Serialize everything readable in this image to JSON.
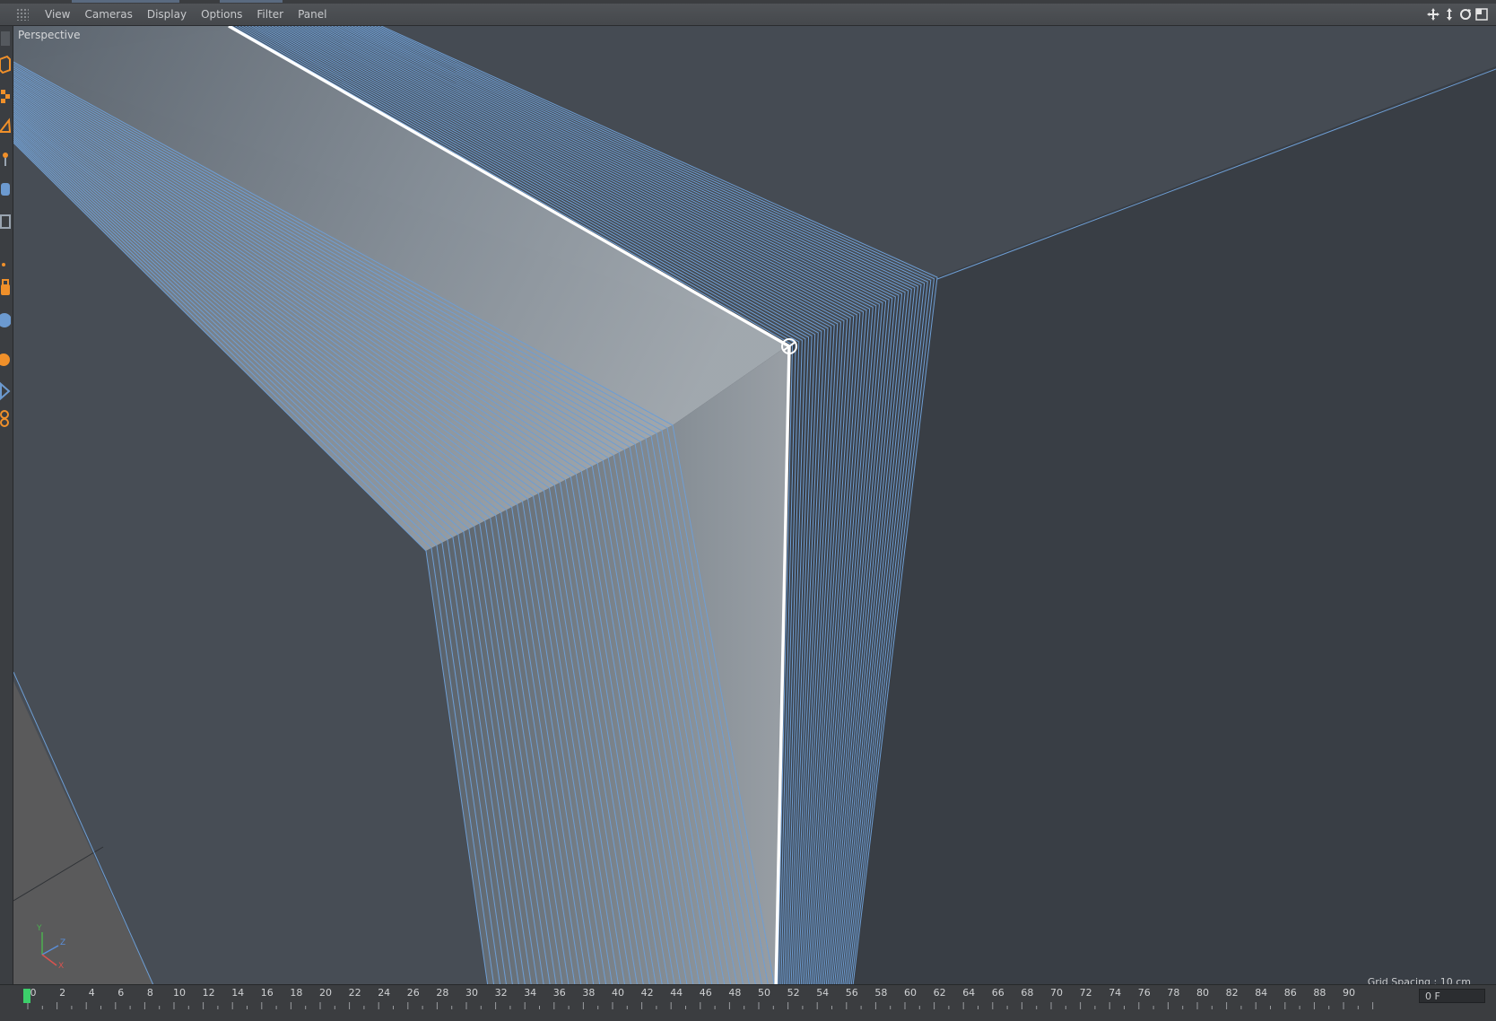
{
  "menubar": {
    "items": [
      "View",
      "Cameras",
      "Display",
      "Options",
      "Filter",
      "Panel"
    ]
  },
  "nav_icons": [
    "move-view-icon",
    "dolly-view-icon",
    "rotate-view-icon",
    "maximize-view-icon"
  ],
  "viewport": {
    "camera_label": "Perspective",
    "grid_spacing": "Grid Spacing : 10 cm",
    "axis_labels": [
      "Y",
      "Z",
      "X"
    ],
    "colors": {
      "background": "#3a3f46",
      "wire": "#6e9ed4",
      "selected_edge": "#ffffff",
      "axis_x": "#d9534f",
      "axis_y": "#4caf50",
      "axis_z": "#5b8fd9"
    }
  },
  "timeline": {
    "ticks": [
      "0",
      "2",
      "4",
      "6",
      "8",
      "10",
      "12",
      "14",
      "16",
      "18",
      "20",
      "22",
      "24",
      "26",
      "28",
      "30",
      "32",
      "34",
      "36",
      "38",
      "40",
      "42",
      "44",
      "46",
      "48",
      "50",
      "52",
      "54",
      "56",
      "58",
      "60",
      "62",
      "64",
      "66",
      "68",
      "70",
      "72",
      "74",
      "76",
      "78",
      "80",
      "82",
      "84",
      "86",
      "88",
      "90"
    ],
    "current_frame": "0 F",
    "playhead_color": "#3ccf6a"
  }
}
